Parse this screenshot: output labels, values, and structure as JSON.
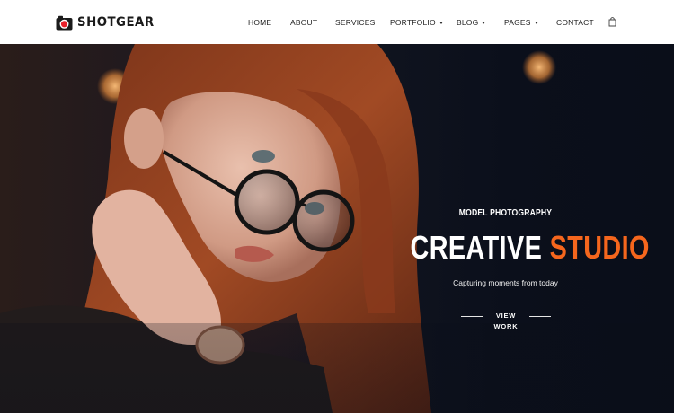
{
  "brand": {
    "name": "SHOTGEAR",
    "icon": "camera-icon",
    "accent": "#e8212b"
  },
  "nav": {
    "items": [
      {
        "label": "HOME",
        "dropdown": false
      },
      {
        "label": "ABOUT",
        "dropdown": false
      },
      {
        "label": "SERVICES",
        "dropdown": false
      },
      {
        "label": "PORTFOLIO",
        "dropdown": true
      },
      {
        "label": "BLOG",
        "dropdown": true
      },
      {
        "label": "PAGES",
        "dropdown": true
      },
      {
        "label": "CONTACT",
        "dropdown": false
      }
    ],
    "cart_icon": "shopping-bag-icon"
  },
  "hero": {
    "tagline": "MODEL PHOTOGRAPHY",
    "headline_part1": "CREATIVE",
    "headline_part2": "STUDIO",
    "subtitle": "Capturing moments from today",
    "cta_label": "VIEW WORK",
    "accent_color": "#f5661d",
    "photo_subject": "woman-with-glasses-portrait"
  }
}
